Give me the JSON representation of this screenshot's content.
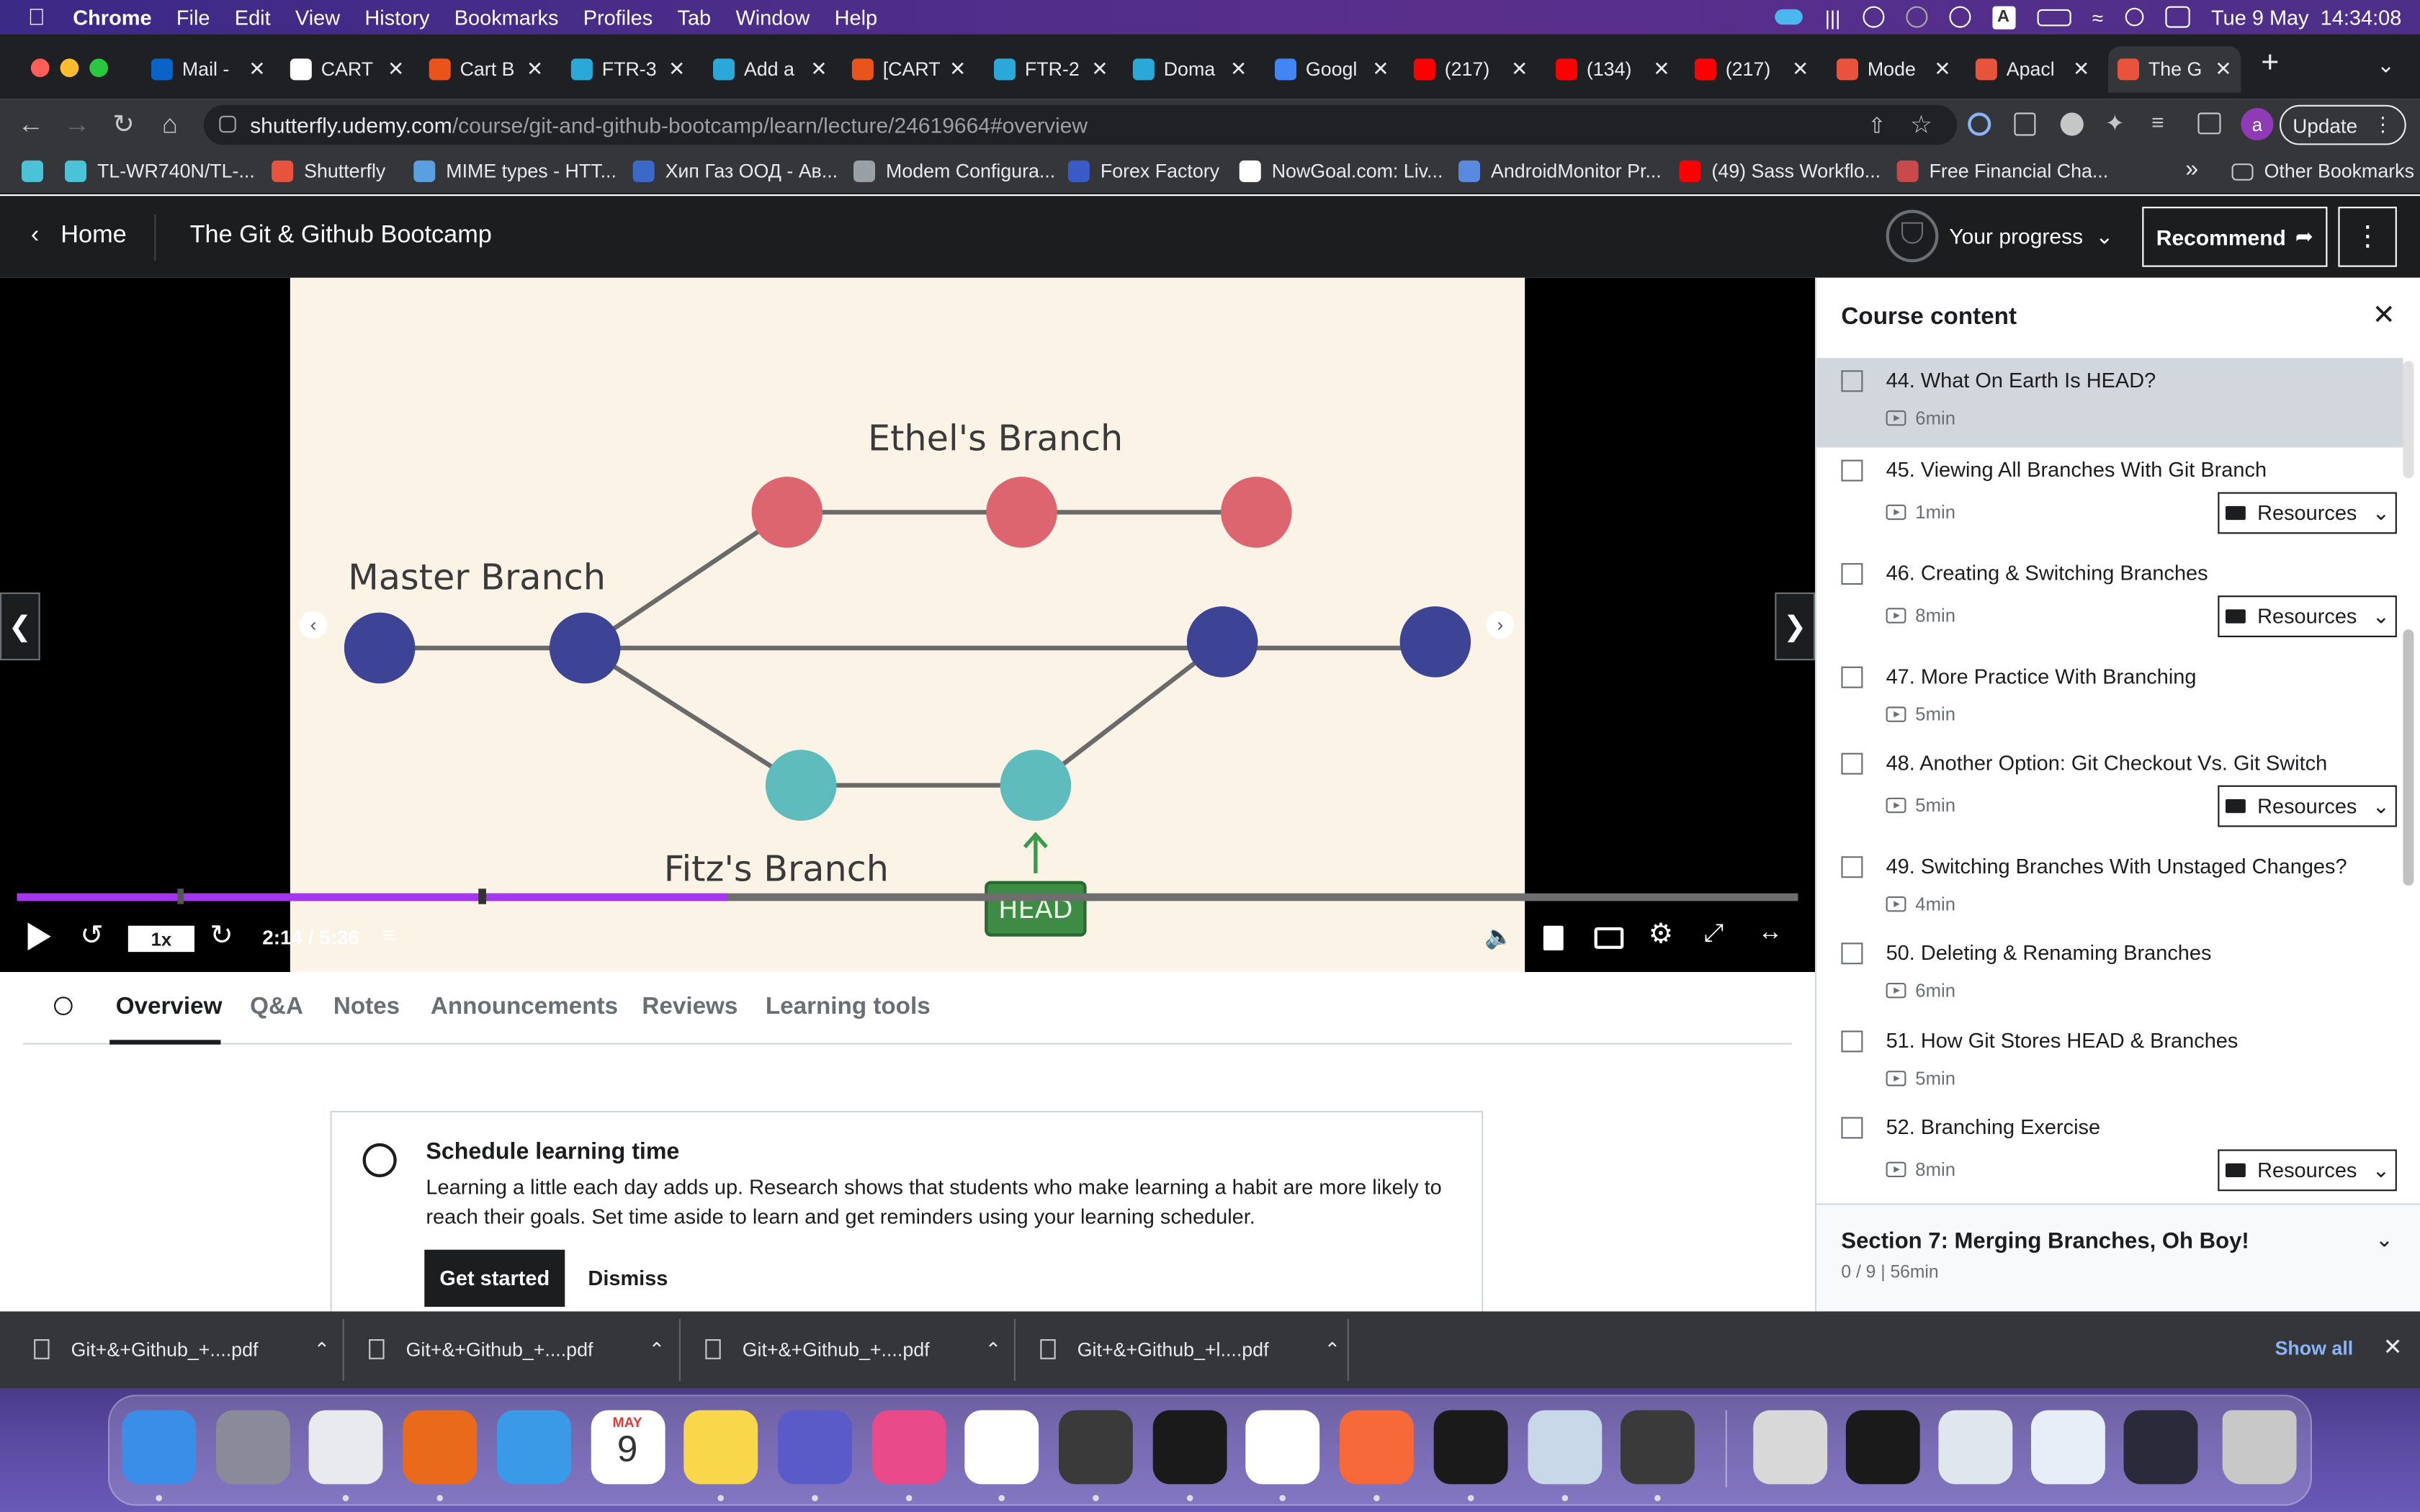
{
  "menubar": {
    "app_name": "Chrome",
    "items": [
      "File",
      "Edit",
      "View",
      "History",
      "Bookmarks",
      "Profiles",
      "Tab",
      "Window",
      "Help"
    ],
    "clock": "Tue 9 May  14:34:08"
  },
  "tabs": [
    {
      "label": "Mail -",
      "icon": "outlook-icon",
      "color": "#0a64c8"
    },
    {
      "label": "CART",
      "icon": "github-icon",
      "color": "#ffffff"
    },
    {
      "label": "Cart B",
      "icon": "jira-icon",
      "color": "#e8541a"
    },
    {
      "label": "FTR-3",
      "icon": "fish-icon",
      "color": "#2aa8d8"
    },
    {
      "label": "Add a",
      "icon": "fish-icon",
      "color": "#2aa8d8"
    },
    {
      "label": "[CART",
      "icon": "jira-icon",
      "color": "#e8541a"
    },
    {
      "label": "FTR-2",
      "icon": "fish-icon",
      "color": "#2aa8d8"
    },
    {
      "label": "Doma",
      "icon": "fish-icon",
      "color": "#2aa8d8"
    },
    {
      "label": "Googl",
      "icon": "google-icon",
      "color": "#4285f4"
    },
    {
      "label": "(217)",
      "icon": "youtube-icon",
      "color": "#ff0000"
    },
    {
      "label": "(134)",
      "icon": "youtube-icon",
      "color": "#ff0000"
    },
    {
      "label": "(217)",
      "icon": "youtube-icon",
      "color": "#ff0000"
    },
    {
      "label": "Mode",
      "icon": "shutterfly-icon",
      "color": "#e8533d"
    },
    {
      "label": "Apacl",
      "icon": "shutterfly-icon",
      "color": "#e8533d"
    },
    {
      "label": "The G",
      "icon": "shutterfly-icon",
      "color": "#e8533d"
    }
  ],
  "address": {
    "host": "shutterfly.udemy.com",
    "path": "/course/git-and-github-bootcamp/learn/lecture/24619664#overview",
    "update_label": "Update",
    "profile_initial": "a"
  },
  "bookmarks": [
    {
      "label": "",
      "icon": "jira-board-icon",
      "color": "#4ac3d8"
    },
    {
      "label": "TL-WR740N/TL-...",
      "icon": "tplink-icon",
      "color": "#4ac3d8"
    },
    {
      "label": "Shutterfly",
      "icon": "shutterfly-icon",
      "color": "#e8533d"
    },
    {
      "label": "MIME types - HTT...",
      "icon": "mdn-icon",
      "color": "#5aa0e0"
    },
    {
      "label": "Хип Газ ООД - Ав...",
      "icon": "hipgas-icon",
      "color": "#3a6ac8"
    },
    {
      "label": "Modem Configura...",
      "icon": "globe-icon",
      "color": "#9aa0a6"
    },
    {
      "label": "Forex Factory",
      "icon": "forex-icon",
      "color": "#3a5ac8"
    },
    {
      "label": "NowGoal.com: Liv...",
      "icon": "google-g-icon",
      "color": "#ffffff"
    },
    {
      "label": "AndroidMonitor Pr...",
      "icon": "wifi-icon",
      "color": "#5a8ae0"
    },
    {
      "label": "(49) Sass Workflo...",
      "icon": "youtube-icon",
      "color": "#ff0000"
    },
    {
      "label": "Free Financial Cha...",
      "icon": "chart-icon",
      "color": "#c84a4a"
    }
  ],
  "bookmarks_more": "»",
  "bookmarks_other": "Other Bookmarks",
  "udemy": {
    "home_label": "Home",
    "course_title": "The Git & Github Bootcamp",
    "progress_label": "Your progress",
    "recommend_label": "Recommend"
  },
  "slide": {
    "ethel": "Ethel's Branch",
    "master": "Master Branch",
    "fitz": "Fitz's Branch",
    "head": "HEAD"
  },
  "player": {
    "speed": "1x",
    "time": "2:14 / 5:36",
    "progress_fraction": 0.399
  },
  "content_tabs": [
    "Overview",
    "Q&A",
    "Notes",
    "Announcements",
    "Reviews",
    "Learning tools"
  ],
  "schedule": {
    "title": "Schedule learning time",
    "body": "Learning a little each day adds up. Research shows that students who make learning a habit are more likely to reach their goals. Set time aside to learn and get reminders using your learning scheduler.",
    "get_started": "Get started",
    "dismiss": "Dismiss"
  },
  "sidebar": {
    "title": "Course content",
    "lectures": [
      {
        "title": "44. What On Earth Is HEAD?",
        "duration": "6min",
        "resources": false,
        "active": true
      },
      {
        "title": "45. Viewing All Branches With Git Branch",
        "duration": "1min",
        "resources": true,
        "active": false
      },
      {
        "title": "46. Creating & Switching Branches",
        "duration": "8min",
        "resources": true,
        "active": false
      },
      {
        "title": "47. More Practice With Branching",
        "duration": "5min",
        "resources": false,
        "active": false
      },
      {
        "title": "48. Another Option: Git Checkout Vs. Git Switch",
        "duration": "5min",
        "resources": true,
        "active": false
      },
      {
        "title": "49. Switching Branches With Unstaged Changes?",
        "duration": "4min",
        "resources": false,
        "active": false
      },
      {
        "title": "50. Deleting & Renaming Branches",
        "duration": "6min",
        "resources": false,
        "active": false
      },
      {
        "title": "51. How Git Stores HEAD & Branches",
        "duration": "5min",
        "resources": false,
        "active": false
      },
      {
        "title": "52. Branching Exercise",
        "duration": "8min",
        "resources": true,
        "active": false
      }
    ],
    "resources_label": "Resources",
    "section_title": "Section 7: Merging Branches, Oh Boy!",
    "section_sub": "0 / 9 | 56min"
  },
  "downloads": [
    "Git+&+Github_+....pdf",
    "Git+&+Github_+....pdf",
    "Git+&+Github_+....pdf",
    "Git+&+Github_+l....pdf"
  ],
  "show_all": "Show all",
  "dock_apps": [
    {
      "icon": "finder-icon",
      "color": "#3a8ee8",
      "running": true
    },
    {
      "icon": "launchpad-icon",
      "color": "#8a8a9a",
      "running": false
    },
    {
      "icon": "chrome-icon",
      "color": "#e8eaed",
      "running": true
    },
    {
      "icon": "firefox-icon",
      "color": "#e86a1a",
      "running": true
    },
    {
      "icon": "safari-icon",
      "color": "#3a9ae8",
      "running": false
    },
    {
      "icon": "calendar-icon",
      "color": "#ffffff",
      "running": false
    },
    {
      "icon": "notes-icon",
      "color": "#f8d84a",
      "running": true
    },
    {
      "icon": "teams-icon",
      "color": "#5a5ac8",
      "running": true
    },
    {
      "icon": "intellij-icon",
      "color": "#e84a8a",
      "running": true
    },
    {
      "icon": "slack-icon",
      "color": "#ffffff",
      "running": true
    },
    {
      "icon": "sublime-icon",
      "color": "#3a3a3a",
      "running": true
    },
    {
      "icon": "terminal-icon",
      "color": "#1a1a1a",
      "running": true
    },
    {
      "icon": "vscode-icon",
      "color": "#ffffff",
      "running": true
    },
    {
      "icon": "postman-icon",
      "color": "#f8693a",
      "running": true
    },
    {
      "icon": "activity-monitor-icon",
      "color": "#1a1a1a",
      "running": true
    },
    {
      "icon": "preview-icon",
      "color": "#c8d8e8",
      "running": true
    },
    {
      "icon": "calculator-icon",
      "color": "#3a3a3a",
      "running": true
    }
  ],
  "dock_calendar": {
    "month": "MAY",
    "day": "9"
  }
}
